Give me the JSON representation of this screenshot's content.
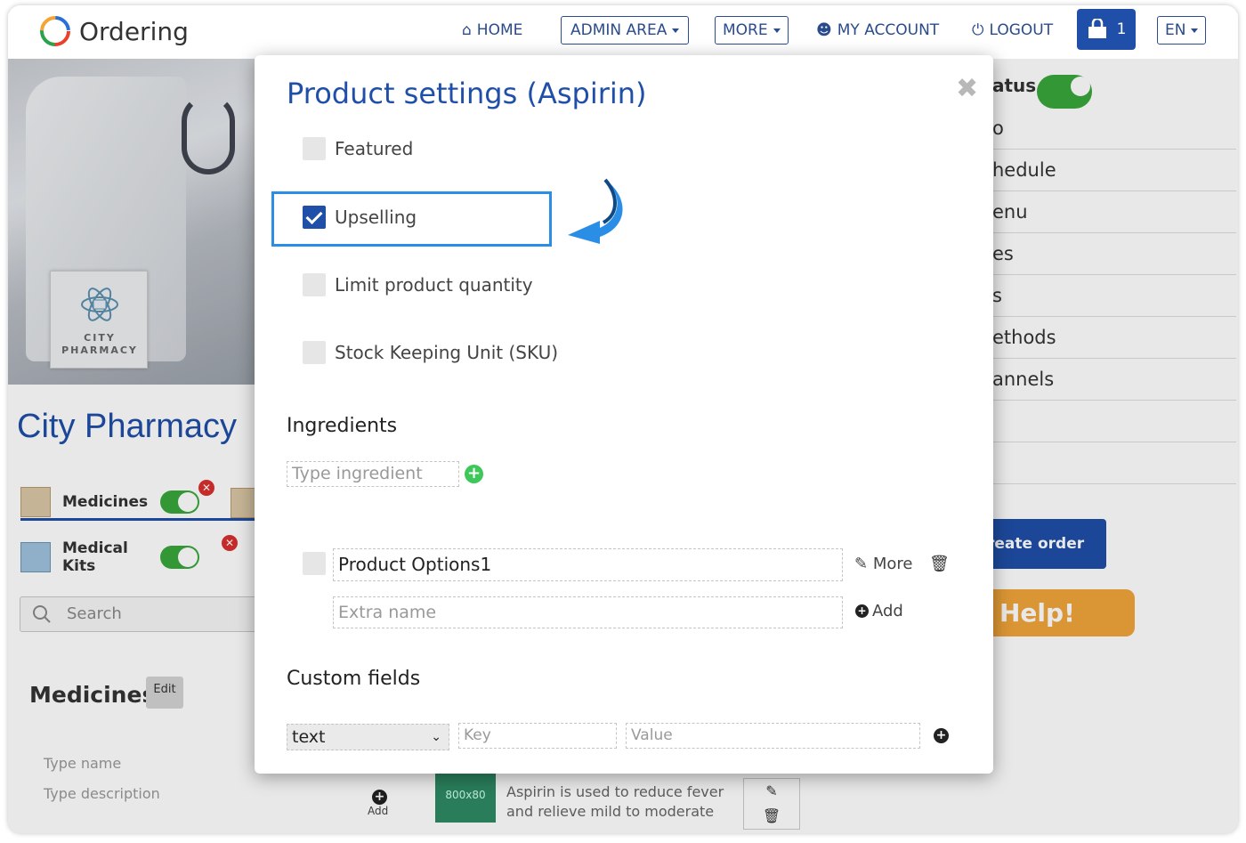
{
  "header": {
    "logo_text": "Ordering",
    "nav": {
      "home": "HOME",
      "admin_area": "ADMIN AREA",
      "more": "MORE",
      "my_account": "MY ACCOUNT",
      "logout": "LOGOUT",
      "cart_count": "1",
      "language": "EN"
    }
  },
  "background": {
    "logo_card_text": "CITY PHARMACY",
    "store_name": "City Pharmacy",
    "categories": [
      {
        "label": "Medicines",
        "enabled": true
      },
      {
        "label": "Medical Kits",
        "enabled": true
      }
    ],
    "search_placeholder": "Search",
    "category_title": "Medicines",
    "edit_label": "Edit",
    "type_name_placeholder": "Type name",
    "type_description_placeholder": "Type description",
    "add_label": "Add",
    "product_image_text": "800x80",
    "product_description": "Aspirin is used to reduce fever and relieve mild to moderate",
    "right_menu": [
      "o",
      "hedule",
      "enu",
      "es",
      "s",
      "ethods",
      "annels"
    ],
    "status_label": "atus",
    "create_order_label": "reate order",
    "help_label": "Help!"
  },
  "modal": {
    "title": "Product settings (Aspirin)",
    "options": [
      {
        "label": "Featured",
        "checked": false
      },
      {
        "label": "Upselling",
        "checked": true
      },
      {
        "label": "Limit product quantity",
        "checked": false
      },
      {
        "label": "Stock Keeping Unit (SKU)",
        "checked": false
      }
    ],
    "ingredients_title": "Ingredients",
    "ingredient_placeholder": "Type ingredient",
    "product_option_value": "Product Options1",
    "more_label": "More",
    "extra_name_placeholder": "Extra name",
    "add_extra_label": "Add",
    "custom_fields_title": "Custom fields",
    "custom_field_type": "text",
    "key_placeholder": "Key",
    "value_placeholder": "Value"
  },
  "colors": {
    "brand_blue": "#1f4fa8",
    "highlight_blue": "#2a8ee6",
    "toggle_green": "#3aa63c",
    "help_orange": "#f0a43a"
  }
}
